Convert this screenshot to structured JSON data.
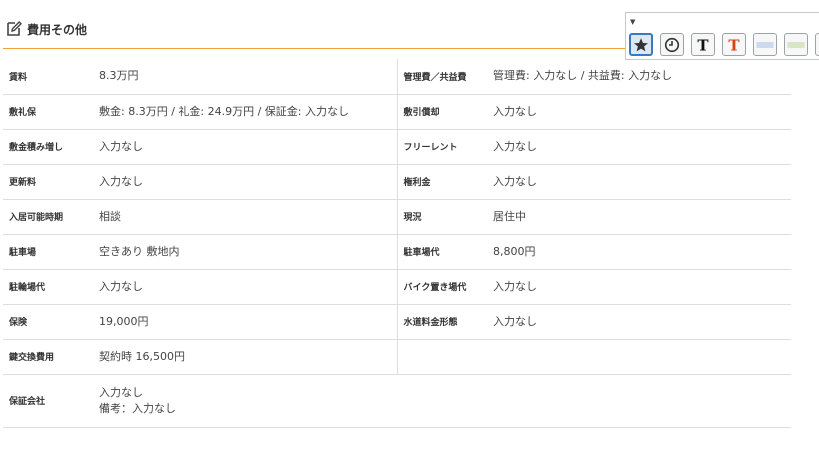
{
  "section": {
    "title": "費用その他",
    "icon": "edit-icon"
  },
  "rows": [
    [
      {
        "label": "賃料",
        "value": [
          "8.3万円"
        ]
      },
      {
        "label": "管理費／共益費",
        "value": [
          "管理費: 入力なし / 共益費: 入力なし"
        ]
      }
    ],
    [
      {
        "label": "敷礼保",
        "value": [
          "敷金: 8.3万円 / 礼金: 24.9万円 / 保証金: 入力なし"
        ]
      },
      {
        "label": "敷引償却",
        "value": [
          "入力なし"
        ]
      }
    ],
    [
      {
        "label": "敷金積み増し",
        "value": [
          "入力なし"
        ]
      },
      {
        "label": "フリーレント",
        "value": [
          "入力なし"
        ]
      }
    ],
    [
      {
        "label": "更新料",
        "value": [
          "入力なし"
        ]
      },
      {
        "label": "権利金",
        "value": [
          "入力なし"
        ]
      }
    ],
    [
      {
        "label": "入居可能時期",
        "value": [
          "相談"
        ]
      },
      {
        "label": "現況",
        "value": [
          "居住中"
        ]
      }
    ],
    [
      {
        "label": "駐車場",
        "value": [
          "空きあり 敷地内"
        ]
      },
      {
        "label": "駐車場代",
        "value": [
          "8,800円"
        ]
      }
    ],
    [
      {
        "label": "駐輪場代",
        "value": [
          "入力なし"
        ]
      },
      {
        "label": "バイク置き場代",
        "value": [
          "入力なし"
        ]
      }
    ],
    [
      {
        "label": "保険",
        "value": [
          "19,000円"
        ]
      },
      {
        "label": "水道料金形態",
        "value": [
          "入力なし"
        ]
      }
    ],
    [
      {
        "label": "鍵交換費用",
        "value": [
          "契約時 16,500円"
        ]
      },
      {
        "label": "",
        "value": []
      }
    ],
    [
      {
        "label": "保証会社",
        "value": [
          "入力なし",
          "備考：入力なし"
        ]
      }
    ]
  ],
  "toolbar": {
    "dropdown": "caret-down-icon",
    "buttons": [
      {
        "name": "star-button",
        "icon": "star-icon",
        "active": true
      },
      {
        "name": "clock-button",
        "icon": "clock-icon"
      },
      {
        "name": "text-black-button",
        "icon": "text-icon",
        "glyph": "T",
        "color": "#111111"
      },
      {
        "name": "text-red-button",
        "icon": "text-icon",
        "glyph": "T",
        "color": "#d9410f"
      },
      {
        "name": "highlight-blue-button",
        "icon": "highlight-icon",
        "color": "#7aa6d9"
      },
      {
        "name": "highlight-green-button",
        "icon": "highlight-icon",
        "color": "#9cc96b"
      },
      {
        "name": "highlight-yellow-button",
        "icon": "highlighter-icon",
        "color": "#f2c01e"
      }
    ]
  }
}
